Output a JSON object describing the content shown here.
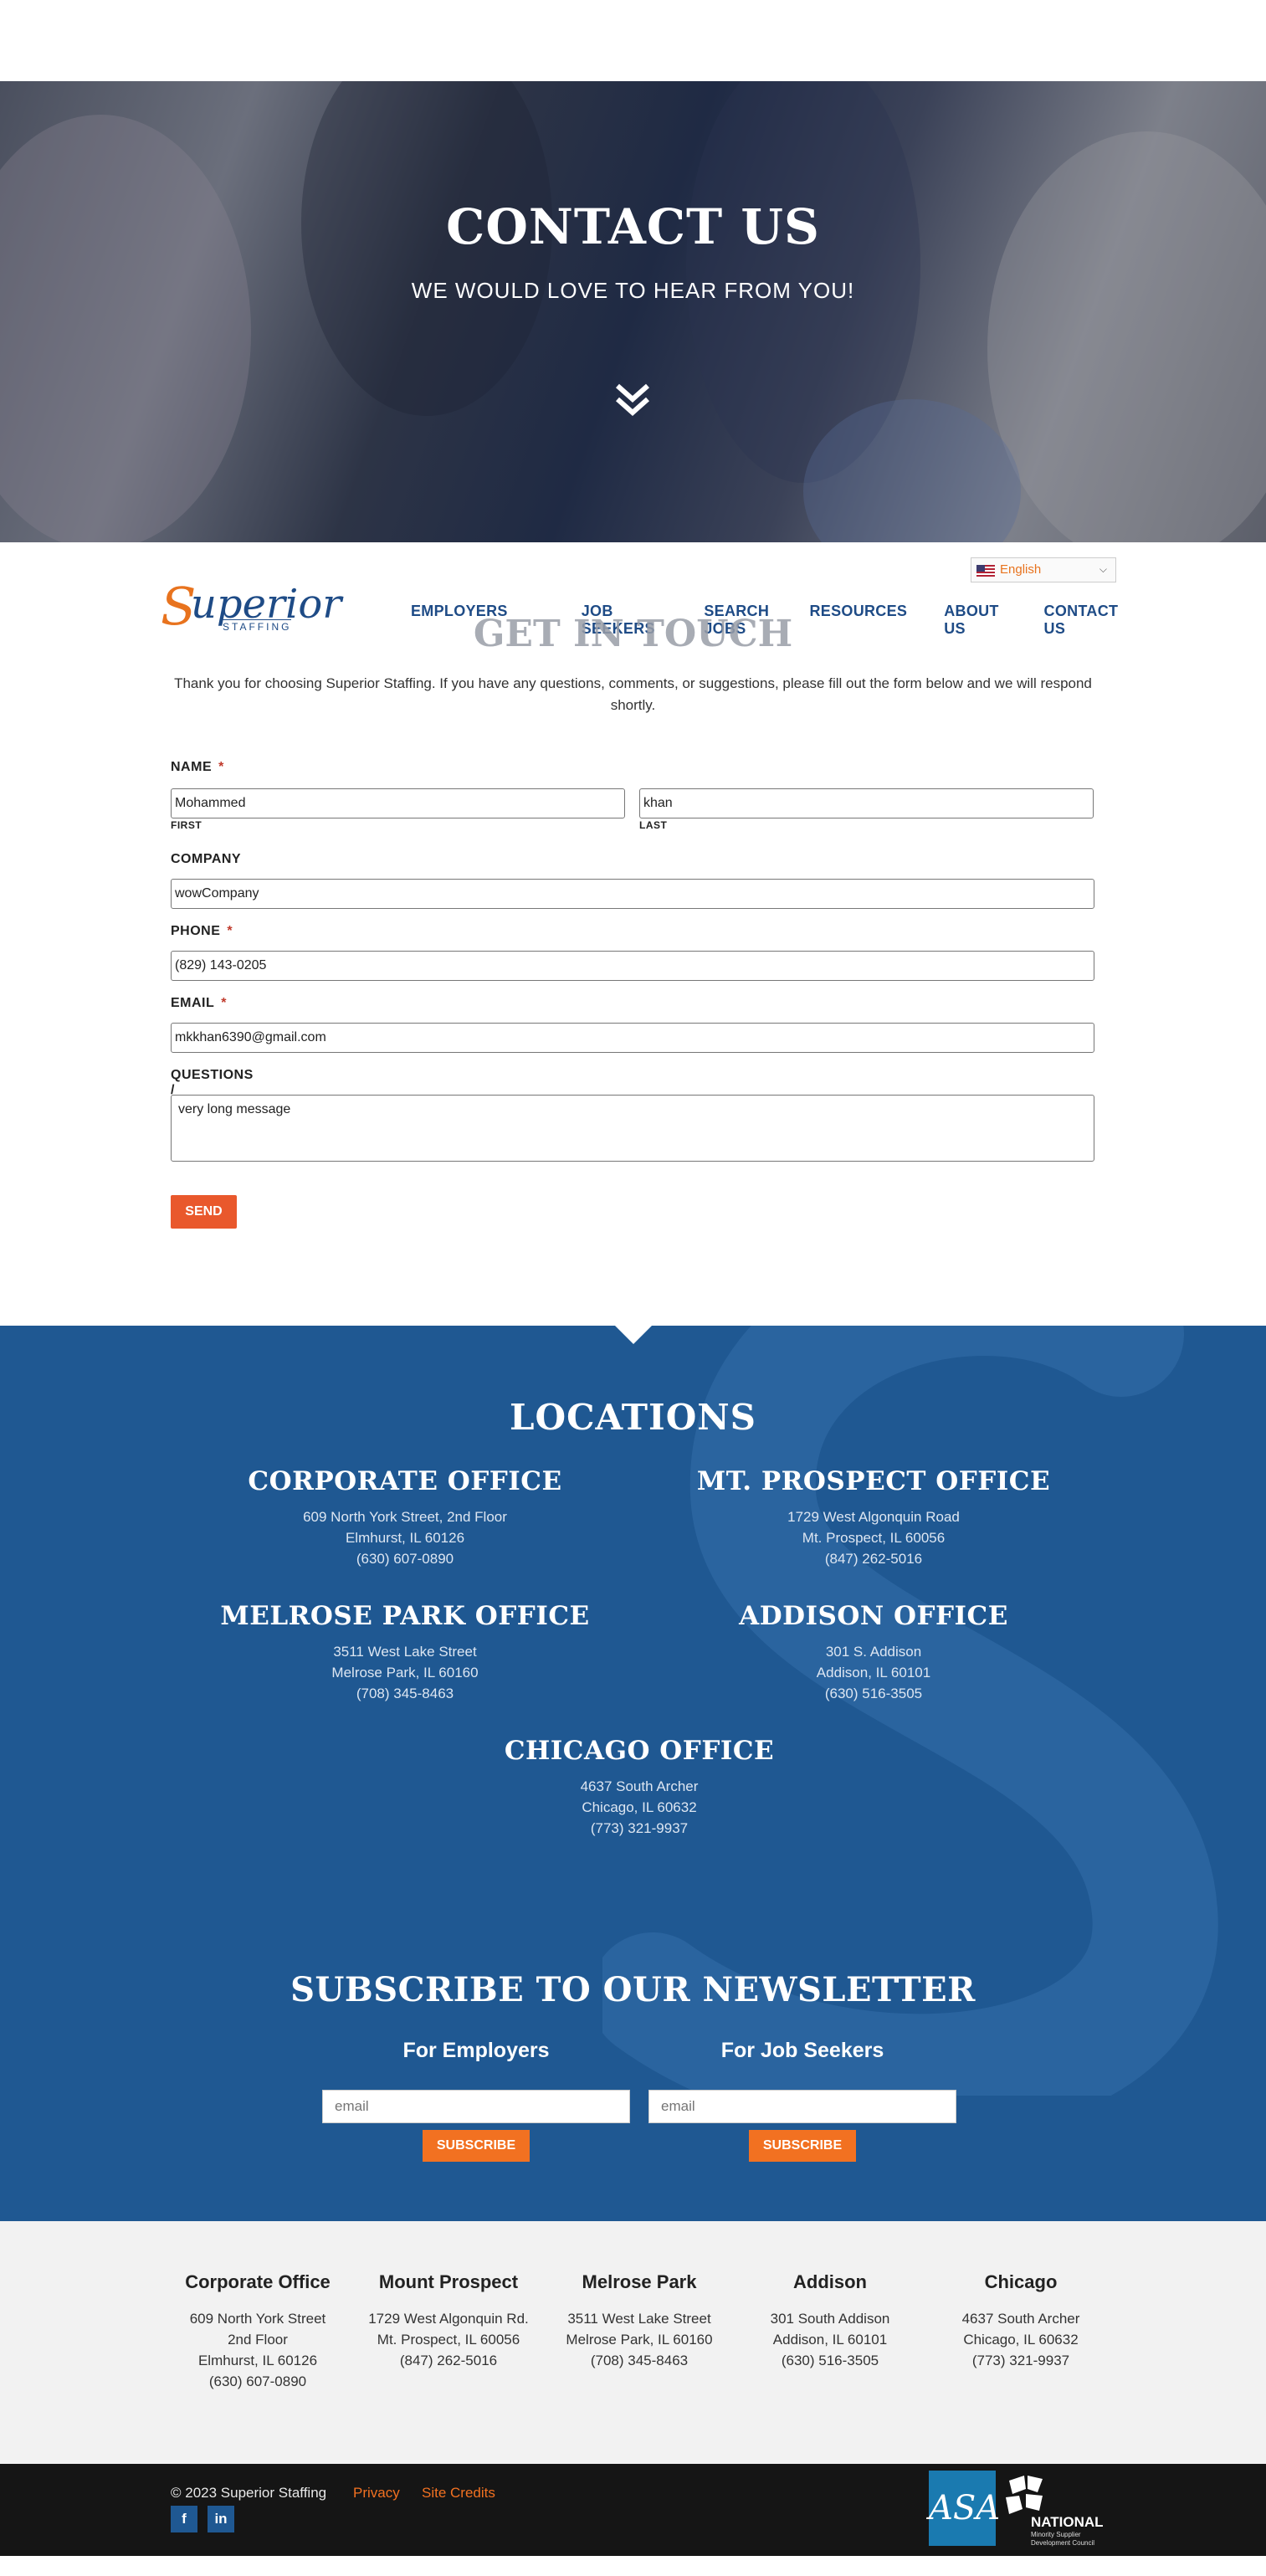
{
  "hero": {
    "title": "CONTACT US",
    "subtitle": "WE WOULD LOVE TO HEAR FROM YOU!"
  },
  "header": {
    "logo_s": "S",
    "logo_word": "uperior",
    "logo_staffing": "STAFFING",
    "language": "English",
    "nav": [
      "EMPLOYERS",
      "JOB SEEKERS",
      "SEARCH JOBS",
      "RESOURCES",
      "ABOUT US",
      "CONTACT US"
    ]
  },
  "get_in_touch": {
    "title": "GET IN TOUCH",
    "text": "Thank you for choosing Superior Staffing. If you have any questions, comments, or suggestions, please fill out the form below and we will respond shortly."
  },
  "form": {
    "name_label": "NAME",
    "required_mark": "*",
    "first_value": "Mohammed",
    "first_label": "FIRST",
    "last_value": "khan",
    "last_label": "LAST",
    "company_label": "COMPANY",
    "company_value": "wowCompany",
    "phone_label": "PHONE",
    "phone_value": "(829) 143-0205",
    "email_label": "EMAIL",
    "email_value": "mkkhan6390@gmail.com",
    "comments_label": "QUESTIONS / COMMENTS",
    "comments_value": "very long message",
    "send_label": "SEND"
  },
  "locations": {
    "title": "LOCATIONS",
    "offices": [
      {
        "name": "CORPORATE OFFICE",
        "line1": "609 North York Street, 2nd Floor",
        "line2": "Elmhurst, IL 60126",
        "phone": "(630) 607-0890"
      },
      {
        "name": "MT. PROSPECT OFFICE",
        "line1": "1729 West Algonquin Road",
        "line2": "Mt. Prospect, IL 60056",
        "phone": "(847) 262-5016"
      },
      {
        "name": "MELROSE PARK OFFICE",
        "line1": "3511 West Lake Street",
        "line2": "Melrose Park, IL 60160",
        "phone": "(708) 345-8463"
      },
      {
        "name": "ADDISON OFFICE",
        "line1": "301 S. Addison",
        "line2": "Addison, IL 60101",
        "phone": "(630) 516-3505"
      },
      {
        "name": "CHICAGO OFFICE",
        "line1": "4637 South Archer",
        "line2": "Chicago, IL 60632",
        "phone": "(773) 321-9937"
      }
    ]
  },
  "newsletter": {
    "title": "SUBSCRIBE TO OUR NEWSLETTER",
    "employers_heading": "For Employers",
    "seekers_heading": "For Job Seekers",
    "placeholder": "email",
    "subscribe_label": "SUBSCRIBE"
  },
  "footer": {
    "columns": [
      {
        "title": "Corporate Office",
        "lines": [
          "609 North York Street",
          "2nd Floor",
          "Elmhurst, IL 60126",
          "(630) 607-0890"
        ]
      },
      {
        "title": "Mount Prospect",
        "lines": [
          "1729 West Algonquin Rd.",
          "Mt. Prospect, IL 60056",
          "(847) 262-5016"
        ]
      },
      {
        "title": "Melrose Park",
        "lines": [
          "3511 West Lake Street",
          "Melrose Park, IL 60160",
          "(708) 345-8463"
        ]
      },
      {
        "title": "Addison",
        "lines": [
          "301 South Addison",
          "Addison, IL 60101",
          "(630) 516-3505"
        ]
      },
      {
        "title": "Chicago",
        "lines": [
          "4637 South Archer",
          "Chicago, IL 60632",
          "(773) 321-9937"
        ]
      }
    ]
  },
  "bottom": {
    "copyright": "© 2023 Superior Staffing",
    "privacy": "Privacy",
    "credits": "Site Credits",
    "facebook": "f",
    "linkedin": "in",
    "asa_logo": "ASA",
    "nmsdc_word": "NATIONAL",
    "nmsdc_sub1": "Minority Supplier",
    "nmsdc_sub2": "Development Council"
  },
  "colors": {
    "brand_blue": "#1f5892",
    "brand_orange": "#f27121",
    "send_red": "#e9582c"
  }
}
